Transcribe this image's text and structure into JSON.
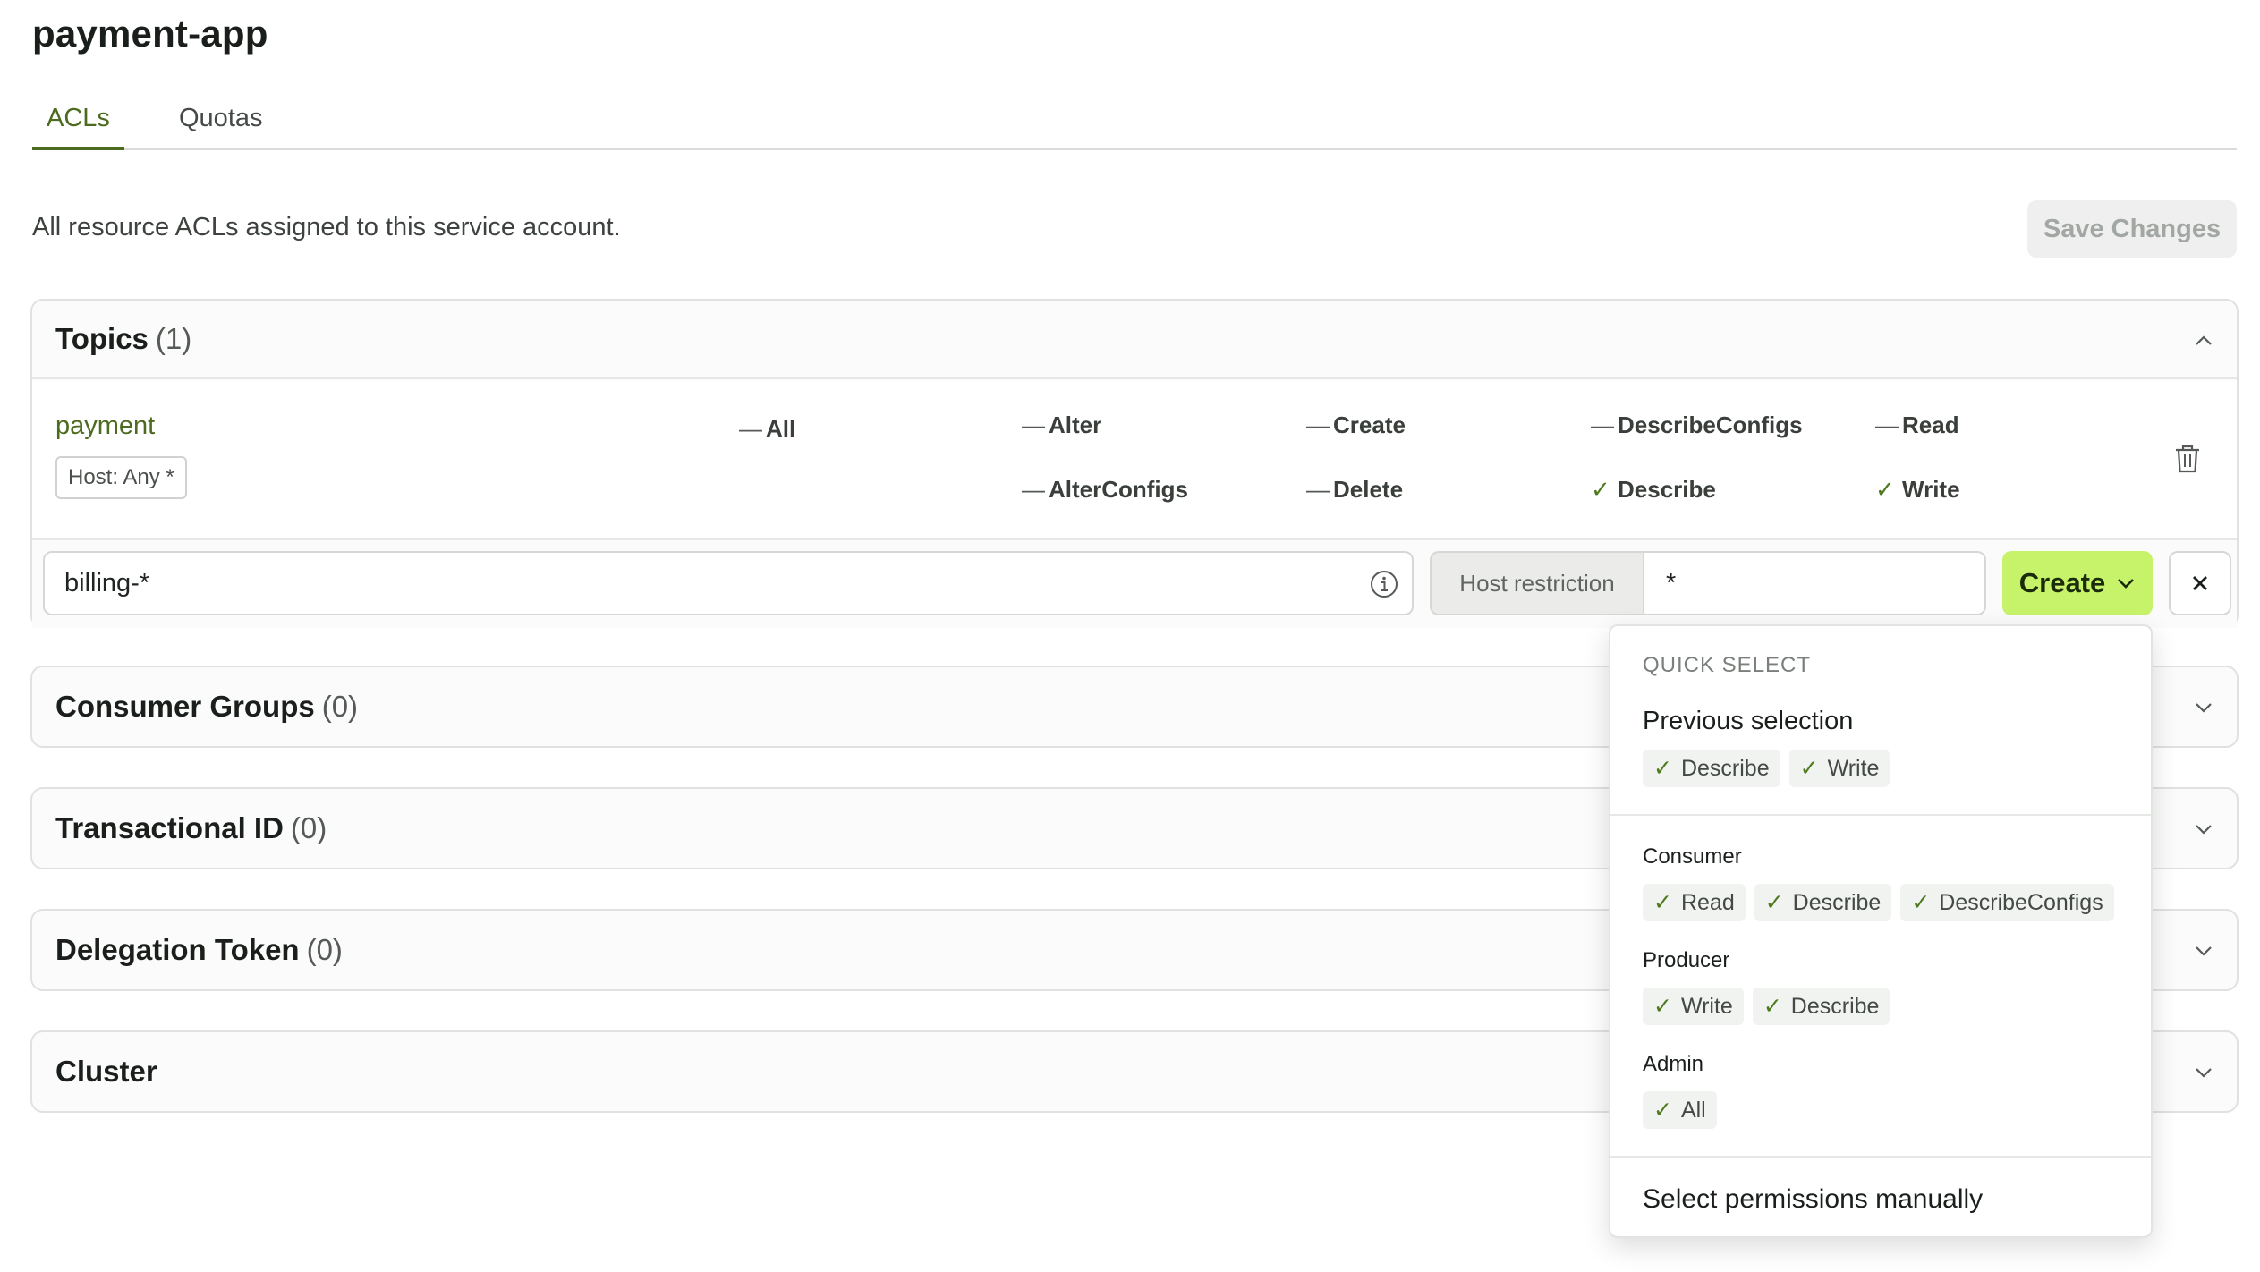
{
  "app": {
    "title": "payment-app"
  },
  "tabs": [
    {
      "label": "ACLs",
      "active": true
    },
    {
      "label": "Quotas",
      "active": false
    }
  ],
  "description": "All resource ACLs assigned to this service account.",
  "save_button": "Save Changes",
  "sections": {
    "topics": {
      "title": "Topics",
      "count": "(1)",
      "expanded": true
    },
    "consumer_groups": {
      "title": "Consumer Groups",
      "count": "(0)"
    },
    "transactional_id": {
      "title": "Transactional ID",
      "count": "(0)"
    },
    "delegation_token": {
      "title": "Delegation Token",
      "count": "(0)"
    },
    "cluster": {
      "title": "Cluster",
      "count": ""
    }
  },
  "topic_row": {
    "name": "payment",
    "host": "Host: Any *",
    "all": {
      "mark": "—",
      "label": "All"
    },
    "permissions": [
      {
        "mark": "—",
        "label": "Alter"
      },
      {
        "mark": "—",
        "label": "Create"
      },
      {
        "mark": "—",
        "label": "DescribeConfigs"
      },
      {
        "mark": "—",
        "label": "Read"
      },
      {
        "mark": "—",
        "label": "AlterConfigs"
      },
      {
        "mark": "—",
        "label": "Delete"
      },
      {
        "mark": "✓",
        "label": "Describe"
      },
      {
        "mark": "✓",
        "label": "Write"
      }
    ]
  },
  "new_acl": {
    "pattern_value": "billing-*",
    "host_label": "Host restriction",
    "host_value": "*",
    "create_label": "Create"
  },
  "quick_select": {
    "title": "QUICK SELECT",
    "previous_heading": "Previous selection",
    "previous": [
      "Describe",
      "Write"
    ],
    "consumer_label": "Consumer",
    "consumer": [
      "Read",
      "Describe",
      "DescribeConfigs"
    ],
    "producer_label": "Producer",
    "producer": [
      "Write",
      "Describe"
    ],
    "admin_label": "Admin",
    "admin": [
      "All"
    ],
    "manual": "Select permissions manually"
  },
  "colors": {
    "accent": "#4c6b1f",
    "create_button": "#c6f36a",
    "check": "#4f7a1e"
  }
}
